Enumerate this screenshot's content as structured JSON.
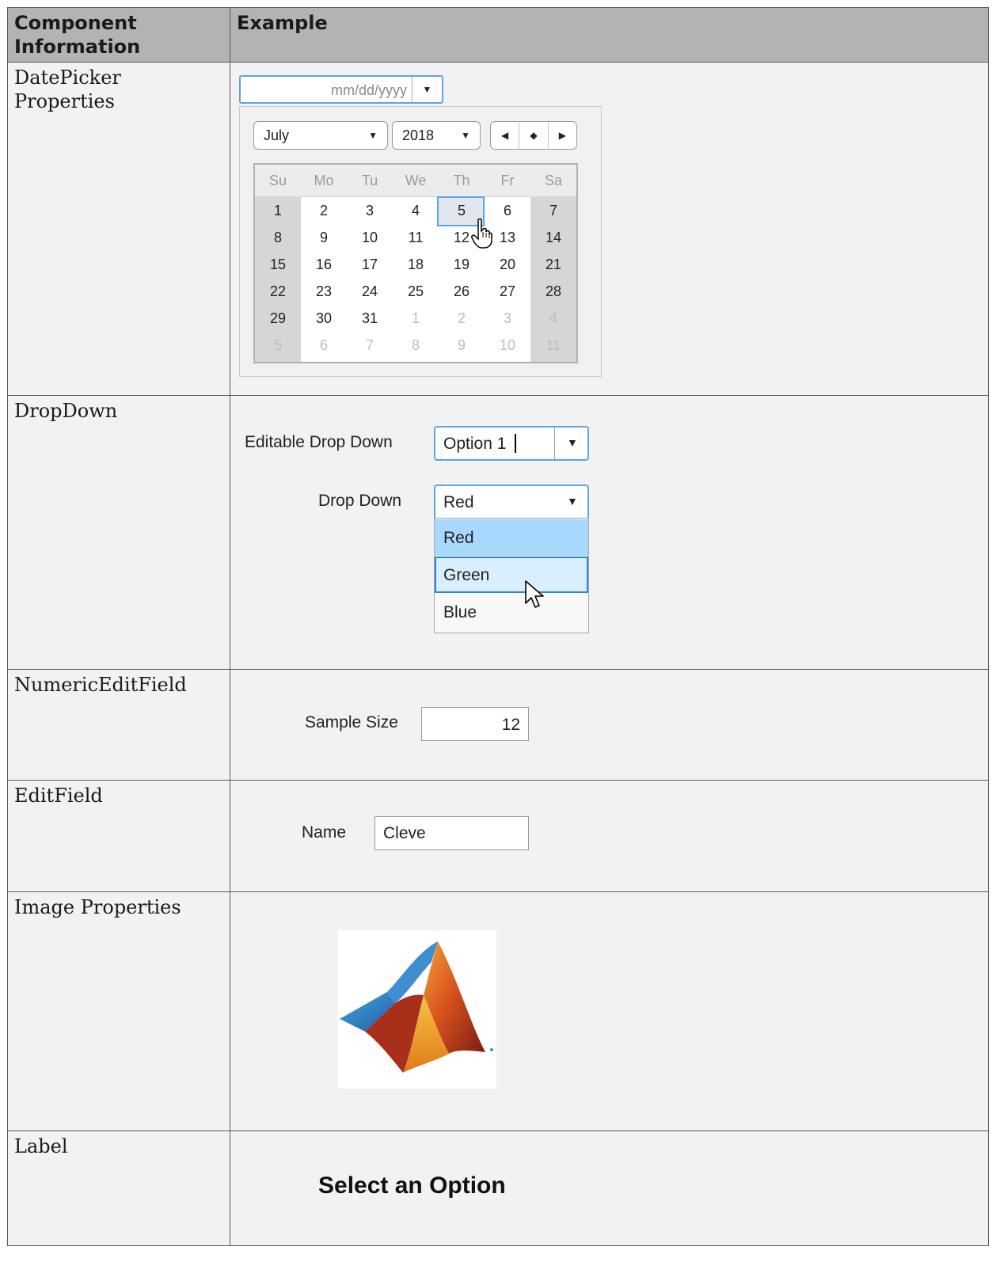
{
  "table": {
    "header_component": "Component Information",
    "header_example": "Example"
  },
  "rows": {
    "datepicker": {
      "name": "DatePicker Properties",
      "placeholder": "mm/dd/yyyy",
      "month": "July",
      "year": "2018",
      "weekdays": [
        "Su",
        "Mo",
        "Tu",
        "We",
        "Th",
        "Fr",
        "Sa"
      ],
      "weeks": [
        [
          "1",
          "2",
          "3",
          "4",
          "5",
          "6",
          "7"
        ],
        [
          "8",
          "9",
          "10",
          "11",
          "12",
          "13",
          "14"
        ],
        [
          "15",
          "16",
          "17",
          "18",
          "19",
          "20",
          "21"
        ],
        [
          "22",
          "23",
          "24",
          "25",
          "26",
          "27",
          "28"
        ],
        [
          "29",
          "30",
          "31",
          "1",
          "2",
          "3",
          "4"
        ],
        [
          "5",
          "6",
          "7",
          "8",
          "9",
          "10",
          "11"
        ]
      ],
      "focused_day": "5"
    },
    "dropdown": {
      "name": "DropDown",
      "editable_label": "Editable Drop Down",
      "editable_value": "Option 1",
      "label": "Drop Down",
      "value": "Red",
      "options": [
        "Red",
        "Green",
        "Blue"
      ]
    },
    "numeric": {
      "name": "NumericEditField",
      "label": "Sample Size",
      "value": "12"
    },
    "editfield": {
      "name": "EditField",
      "label": "Name",
      "value": "Cleve"
    },
    "image": {
      "name": "Image Properties",
      "logo_icon": "membrane-logo-icon"
    },
    "label": {
      "name": "Label",
      "text": "Select an Option"
    }
  },
  "colors": {
    "header_bg": "#b3b3b3",
    "focus_blue": "#5aa6e6",
    "selected_option": "#a9d8ff",
    "hover_option": "#d9efff"
  }
}
